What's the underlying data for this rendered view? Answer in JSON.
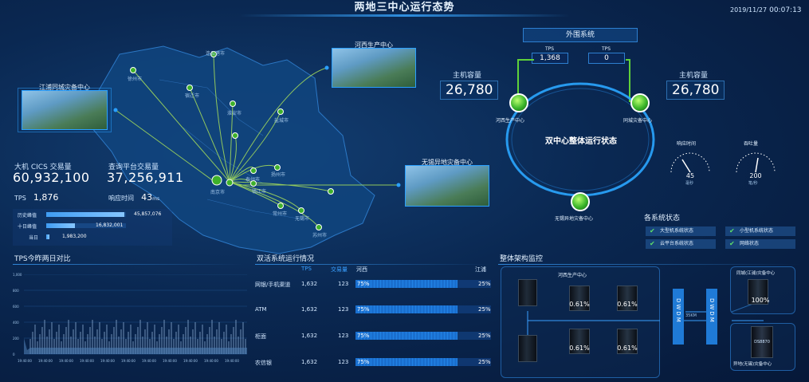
{
  "header": {
    "title": "两地三中心运行态势",
    "date": "2019/11/27",
    "time": "00:07:13"
  },
  "map": {
    "cities": [
      "徐州市",
      "连云港市",
      "宿迁市",
      "淮安市",
      "盐城市",
      "南京市",
      "扬州市",
      "泰州市",
      "镇江市",
      "常州市",
      "无锡市",
      "苏州市"
    ],
    "photos": {
      "jiangpu": "江浦同城灾备中心",
      "hexi": "河西生产中心",
      "wuxi": "无锡异地灾备中心"
    }
  },
  "kpis": {
    "cics_label": "大机 CICS 交易量",
    "cics_value": "60,932,100",
    "query_label": "查询平台交易量",
    "query_value": "37,256,911",
    "tps_label": "TPS",
    "tps_value": "1,876",
    "resp_label": "响应时间",
    "resp_value": "43",
    "resp_unit": "ms"
  },
  "peaks": [
    {
      "label": "历史峰值",
      "value": "45,857,076",
      "fraction": 0.98
    },
    {
      "label": "十日峰值",
      "value": "16,832,001",
      "fraction": 0.36
    },
    {
      "label": "当日",
      "value": "1,983,200",
      "fraction": 0.04
    }
  ],
  "external": {
    "title": "外围系统",
    "tps_a_label": "TPS",
    "tps_a": "1,368",
    "tps_b_label": "TPS",
    "tps_b": "0"
  },
  "hosts": {
    "left_label": "主机容量",
    "left_value": "26,780",
    "right_label": "主机容量",
    "right_value": "26,780"
  },
  "ring": {
    "center": "双中心整体运行状态",
    "node_left": "河西生产中心",
    "node_right": "同城灾备中心",
    "node_bottom": "无锡异地灾备中心"
  },
  "gauges": [
    {
      "label": "响应时间",
      "value": "45",
      "unit": "毫秒"
    },
    {
      "label": "吞吐量",
      "value": "200",
      "unit": "笔/秒"
    }
  ],
  "systems": {
    "title": "各系统状态",
    "items": [
      "大型机系统状态",
      "小型机系统状态",
      "云平台系统状态",
      "网络状态"
    ]
  },
  "tps_chart": {
    "title": "TPS今昨两日对比",
    "y_ticks": [
      "1,000",
      "800",
      "600",
      "400",
      "200",
      "0"
    ],
    "x_ticks": [
      "19:40:00",
      "19:40:00",
      "19:40:00",
      "19:40:00",
      "19:40:00",
      "19:40:00",
      "19:40:00",
      "19:40:00",
      "19:40:00",
      "19:40:00",
      "19:40:00"
    ]
  },
  "dual": {
    "title": "双活系统运行情况",
    "col_tps": "TPS",
    "col_vol": "交易量",
    "col_hexi": "河西",
    "col_jiangpu": "江浦",
    "rows": [
      {
        "name": "网银/手机渠道",
        "tps": "1,632",
        "vol": "123",
        "left": "75%",
        "right": "25%",
        "fraction": 0.75
      },
      {
        "name": "ATM",
        "tps": "1,632",
        "vol": "123",
        "left": "75%",
        "right": "25%",
        "fraction": 0.75
      },
      {
        "name": "柜面",
        "tps": "1,632",
        "vol": "123",
        "left": "75%",
        "right": "25%",
        "fraction": 0.75
      },
      {
        "name": "农信银",
        "tps": "1,632",
        "vol": "123",
        "left": "75%",
        "right": "25%",
        "fraction": 0.75
      }
    ]
  },
  "arch": {
    "title": "整体架构监控",
    "hexi_box": "河西生产中心",
    "pcts": [
      "0.61%",
      "0.61%",
      "0.61%",
      "0.61%"
    ],
    "dwdm": "DWDM",
    "distance": "35KM",
    "jiangpu_box": "同城(江浦)灾备中心",
    "jiangpu_pct": "100%",
    "wuxi_box": "异地(无锡)灾备中心",
    "ds8870": "DS8870"
  },
  "colors": {
    "accent": "#2aa0ff",
    "green": "#4fc83a",
    "bg": "#06193a"
  }
}
